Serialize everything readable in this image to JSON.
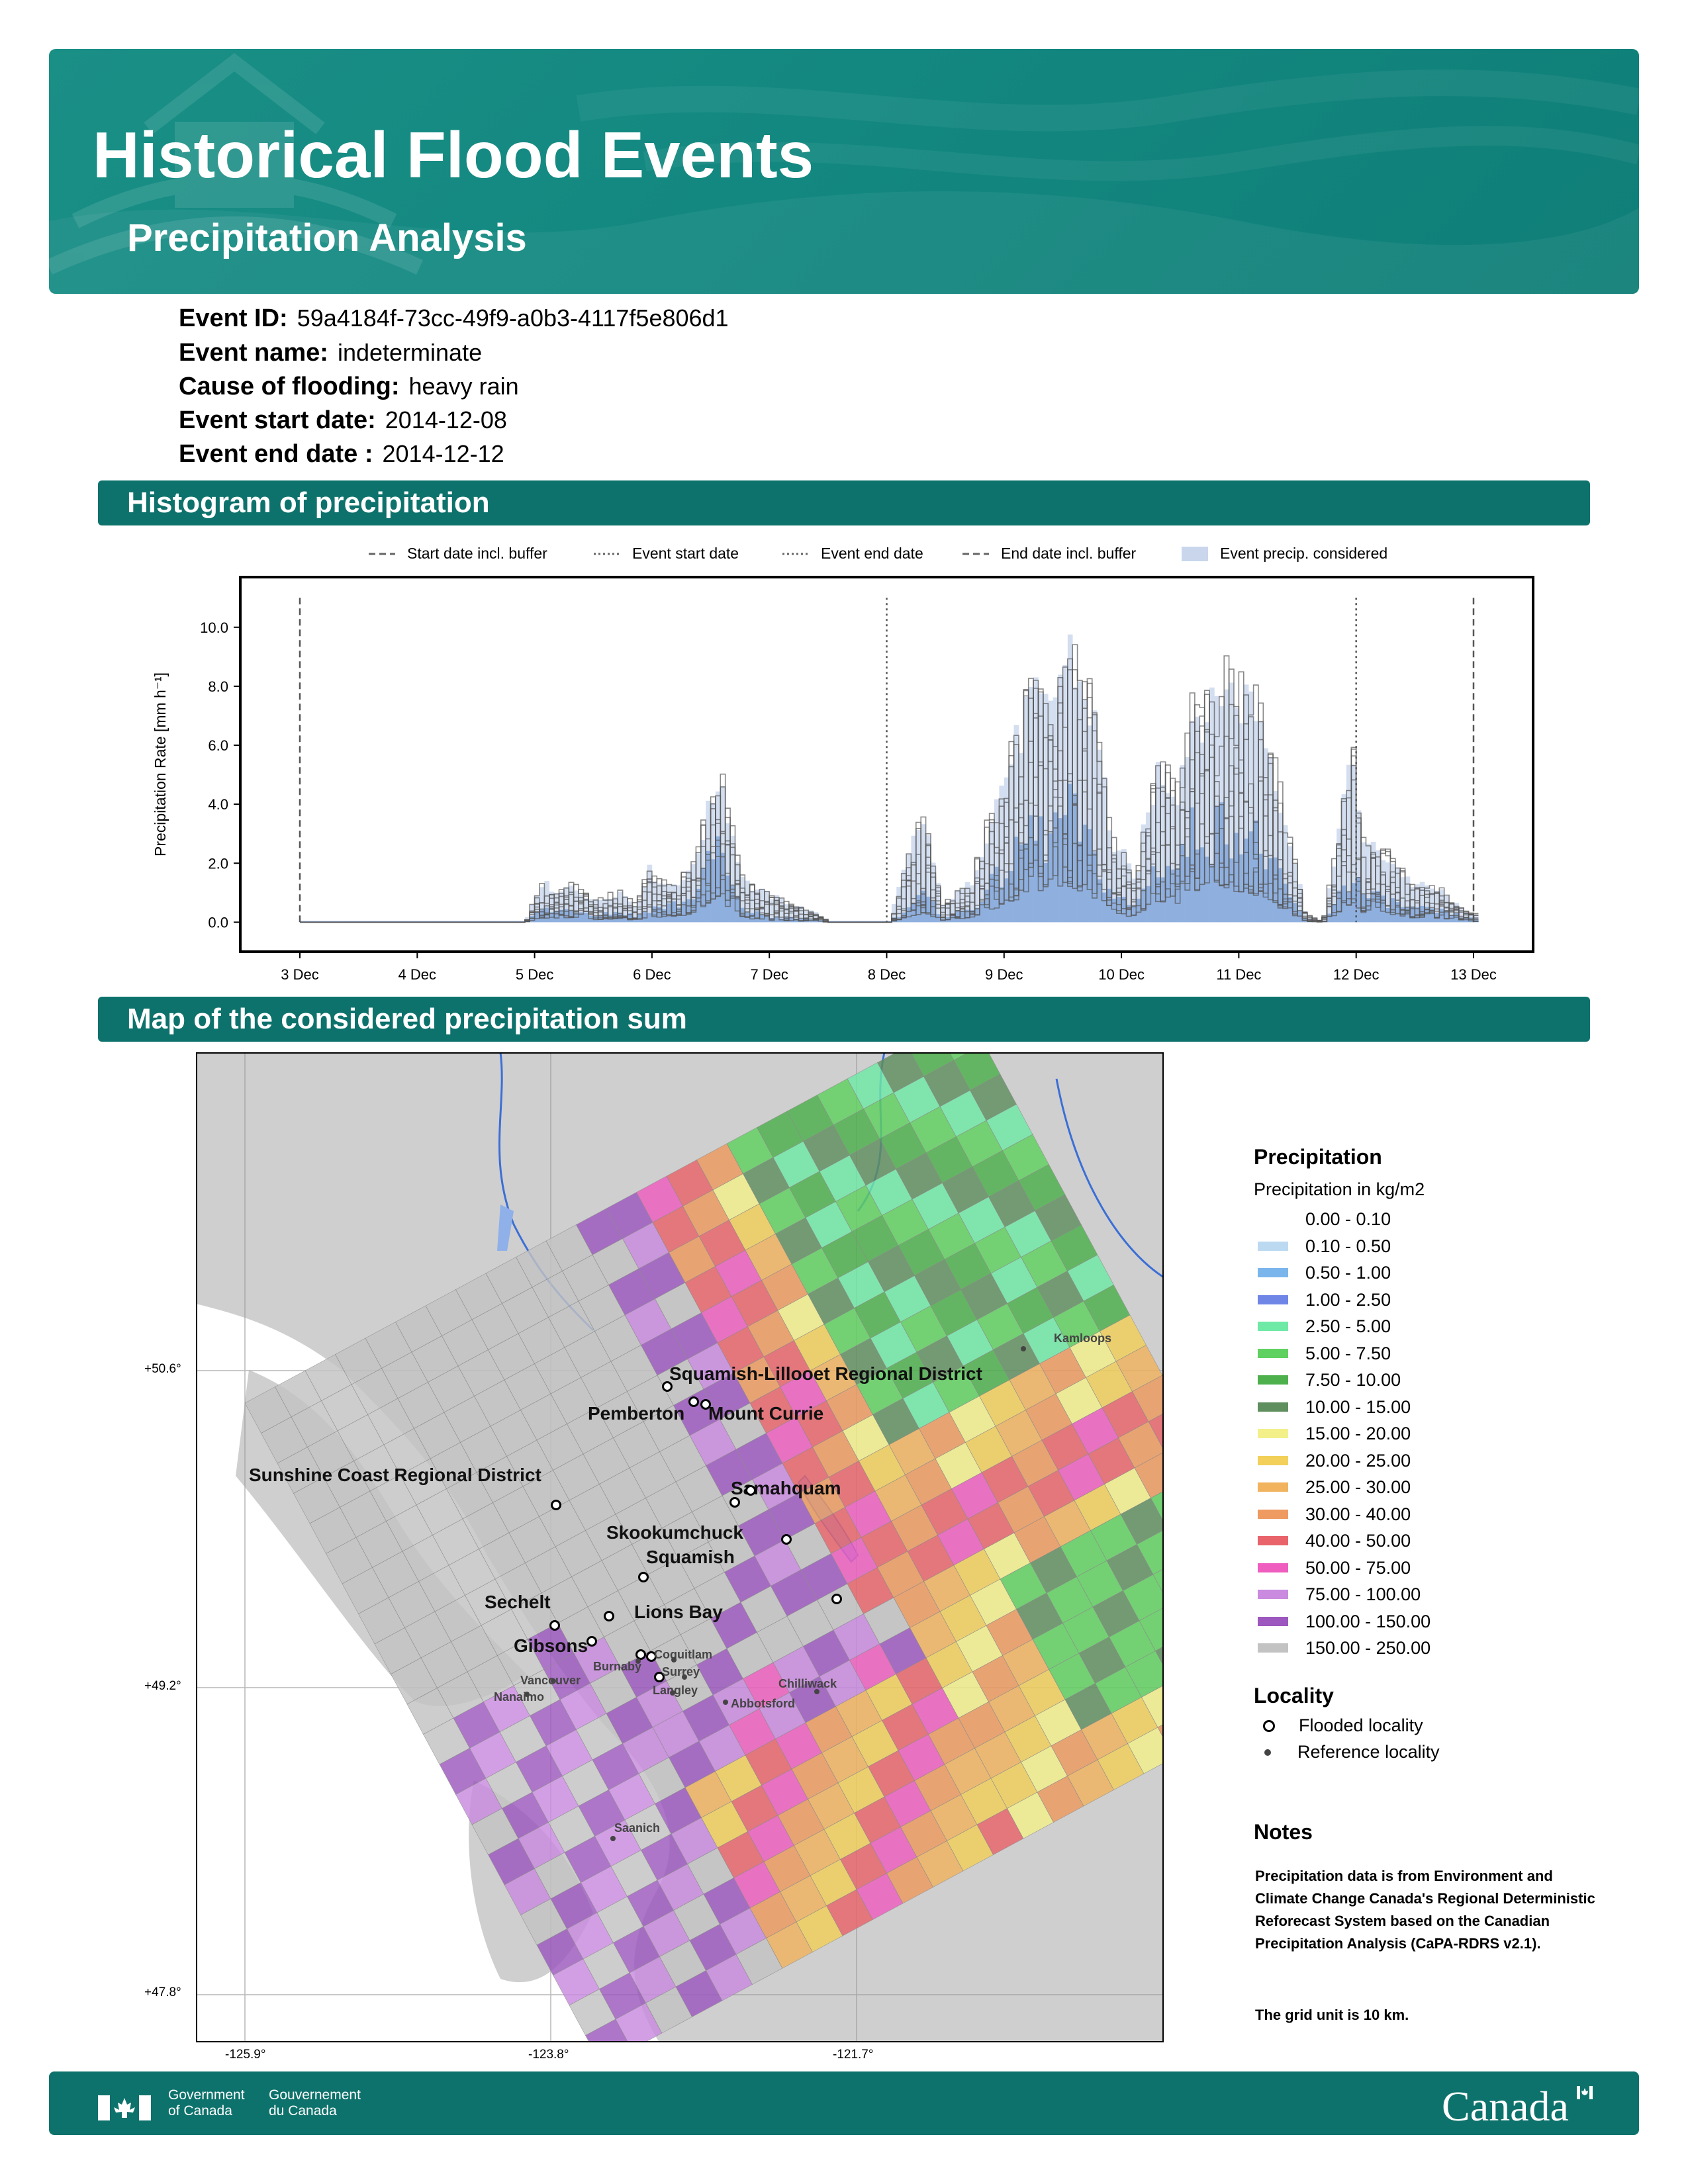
{
  "header": {
    "title": "Historical Flood Events",
    "subtitle": "Precipitation Analysis"
  },
  "event": {
    "id_label": "Event ID:",
    "id_value": "59a4184f-73cc-49f9-a0b3-4117f5e806d1",
    "name_label": "Event name:",
    "name_value": "indeterminate",
    "cause_label": "Cause of flooding:",
    "cause_value": "heavy rain",
    "start_label": "Event start date:",
    "start_value": "2014-12-08",
    "end_label": "Event end date :",
    "end_value": "2014-12-12"
  },
  "sections": {
    "histogram": "Histogram of precipitation",
    "map": "Map of the considered precipitation sum"
  },
  "chart_data": [
    {
      "type": "area",
      "ylabel": "Precipitation Rate [mm h⁻¹]",
      "xlabel": "",
      "ylim": [
        -1.0,
        11.7
      ],
      "yticks": [
        "0.0",
        "2.0",
        "4.0",
        "6.0",
        "8.0",
        "10.0"
      ],
      "x_tick_labels": [
        "3 Dec",
        "4 Dec",
        "5 Dec",
        "6 Dec",
        "7 Dec",
        "8 Dec",
        "9 Dec",
        "10 Dec",
        "11 Dec",
        "12 Dec",
        "13 Dec"
      ],
      "legend": [
        "Start date incl. buffer",
        "Event start date",
        "Event end date",
        "End date incl. buffer",
        "Event precip. considered"
      ],
      "legend_position": "top",
      "reference_lines": [
        {
          "name": "Start date incl. buffer",
          "x": "3 Dec",
          "style": "dashed"
        },
        {
          "name": "Event start date",
          "x": "8 Dec",
          "style": "dotted"
        },
        {
          "name": "Event end date",
          "x": "12 Dec",
          "style": "dotted"
        },
        {
          "name": "End date incl. buffer",
          "x": "13 Dec",
          "style": "dashed"
        }
      ],
      "envelope": {
        "x_day": [
          3.0,
          4.9,
          5.05,
          5.15,
          5.3,
          5.5,
          5.7,
          5.85,
          5.95,
          6.1,
          6.3,
          6.45,
          6.55,
          6.6,
          6.7,
          6.8,
          7.0,
          7.4,
          7.5,
          8.0,
          8.2,
          8.3,
          8.45,
          8.55,
          8.7,
          8.9,
          9.1,
          9.2,
          9.35,
          9.45,
          9.55,
          9.63,
          9.68,
          9.78,
          9.9,
          10.0,
          10.1,
          10.15,
          10.3,
          10.45,
          10.6,
          10.75,
          10.85,
          10.95,
          11.1,
          11.25,
          11.4,
          11.55,
          11.7,
          11.85,
          11.95,
          12.05,
          12.25,
          12.45,
          12.7,
          12.9,
          13.0
        ],
        "max": [
          0.0,
          0.0,
          1.6,
          1.0,
          1.4,
          0.8,
          1.2,
          0.6,
          2.0,
          1.4,
          1.8,
          4.0,
          5.7,
          5.0,
          2.5,
          1.4,
          1.0,
          0.3,
          0.0,
          0.0,
          3.0,
          4.0,
          0.6,
          1.0,
          1.5,
          4.5,
          7.0,
          8.5,
          8.0,
          9.5,
          10.5,
          9.0,
          8.8,
          7.0,
          3.0,
          2.5,
          1.4,
          3.0,
          6.0,
          5.0,
          8.2,
          8.0,
          9.4,
          8.5,
          8.7,
          6.5,
          3.5,
          0.3,
          0.0,
          4.0,
          6.2,
          3.0,
          2.5,
          1.5,
          1.2,
          0.4,
          0.3
        ],
        "median": [
          0.0,
          0.0,
          0.5,
          0.4,
          0.5,
          0.3,
          0.4,
          0.2,
          0.5,
          0.6,
          0.8,
          2.0,
          3.0,
          2.0,
          0.8,
          0.4,
          0.2,
          0.1,
          0.0,
          0.0,
          0.7,
          1.0,
          0.2,
          0.3,
          0.5,
          1.5,
          2.5,
          3.5,
          3.0,
          3.8,
          4.0,
          3.5,
          3.0,
          2.0,
          1.0,
          0.8,
          0.5,
          1.2,
          2.2,
          2.0,
          3.5,
          3.2,
          3.8,
          3.5,
          3.2,
          2.2,
          1.0,
          0.1,
          0.0,
          1.2,
          1.8,
          1.0,
          0.8,
          0.5,
          0.4,
          0.2,
          0.1
        ]
      }
    },
    {
      "type": "heatmap",
      "title": "Precipitation",
      "legend_subtitle": "Precipitation in kg/m2",
      "lat_ticks": [
        "+50.6°",
        "+49.2°",
        "+47.8°"
      ],
      "lon_ticks": [
        "-125.9°",
        "-123.8°",
        "-121.7°"
      ],
      "classes": [
        {
          "range": "0.00 - 0.10",
          "color": "#ffffff"
        },
        {
          "range": "0.10 - 0.50",
          "color": "#bcd9f2"
        },
        {
          "range": "0.50 - 1.00",
          "color": "#7ab6ec"
        },
        {
          "range": "1.00 - 2.50",
          "color": "#6f86e6"
        },
        {
          "range": "2.50 - 5.00",
          "color": "#6fe9a6"
        },
        {
          "range": "5.00 - 7.50",
          "color": "#5fd160"
        },
        {
          "range": "7.50 - 10.00",
          "color": "#4db04c"
        },
        {
          "range": "10.00 - 15.00",
          "color": "#5f8f5e"
        },
        {
          "range": "15.00 - 20.00",
          "color": "#f3f08a"
        },
        {
          "range": "20.00 - 25.00",
          "color": "#f2d05a"
        },
        {
          "range": "25.00 - 30.00",
          "color": "#f1b35e"
        },
        {
          "range": "30.00 - 40.00",
          "color": "#ee9a60"
        },
        {
          "range": "40.00 - 50.00",
          "color": "#e8646a"
        },
        {
          "range": "50.00 - 75.00",
          "color": "#ef5dbe"
        },
        {
          "range": "75.00 - 100.00",
          "color": "#c98ae0"
        },
        {
          "range": "100.00 - 150.00",
          "color": "#9c58be"
        },
        {
          "range": "150.00 - 250.00",
          "color": "#c3c3c3"
        }
      ],
      "locality_title": "Locality",
      "locality_legend": [
        "Flooded locality",
        "Reference locality"
      ],
      "region_labels": [
        "Squamish-Lillooet Regional District",
        "Sunshine Coast Regional District",
        "Pemberton",
        "Mount Currie",
        "Samahquam",
        "Skookumchuck",
        "Squamish",
        "Lions Bay",
        "Sechelt",
        "Gibsons"
      ],
      "reference_labels": [
        "Kamloops",
        "Burnaby",
        "Coquitlam",
        "Surrey",
        "Langley",
        "Vancouver",
        "Nanaimo",
        "Chilliwack",
        "Abbotsford",
        "Saanich"
      ]
    }
  ],
  "notes": {
    "title": "Notes",
    "text": "Precipitation data is from Environment and Climate Change Canada's Regional Deterministic Reforecast System based on the Canadian Precipitation Analysis (CaPA-RDRS v2.1).",
    "grid": "The grid unit is 10 km."
  },
  "footer": {
    "gov_en_1": "Government",
    "gov_en_2": "of Canada",
    "gov_fr_1": "Gouvernement",
    "gov_fr_2": "du Canada",
    "wordmark": "Canada"
  }
}
